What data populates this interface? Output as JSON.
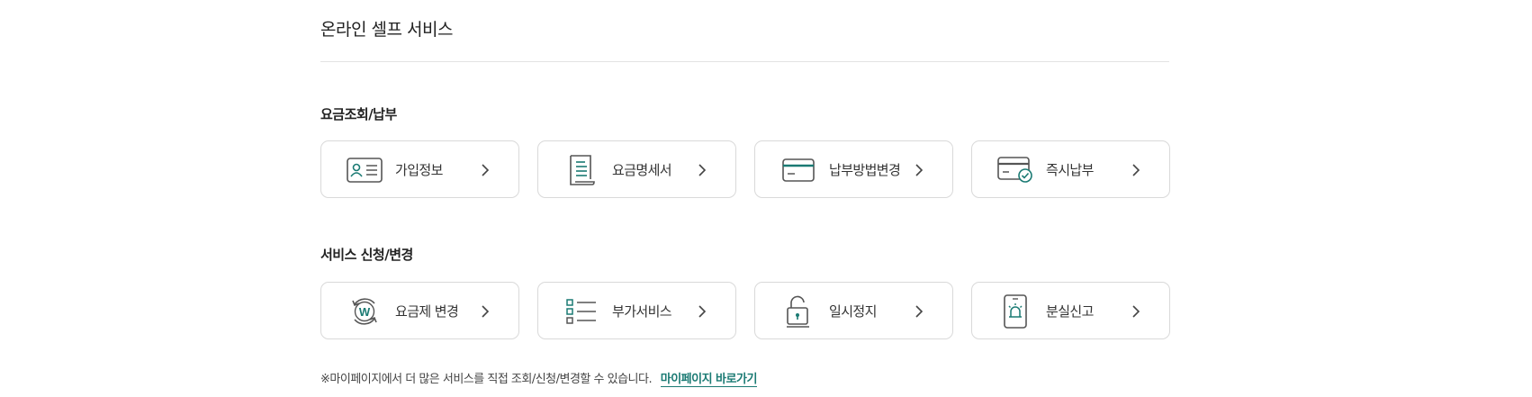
{
  "page": {
    "title": "온라인 셀프 서비스"
  },
  "sections": [
    {
      "title": "요금조회/납부",
      "items": [
        {
          "label": "가입정보",
          "icon": "id-card-icon"
        },
        {
          "label": "요금명세서",
          "icon": "bill-document-icon"
        },
        {
          "label": "납부방법변경",
          "icon": "credit-card-icon"
        },
        {
          "label": "즉시납부",
          "icon": "card-check-icon"
        }
      ]
    },
    {
      "title": "서비스 신청/변경",
      "items": [
        {
          "label": "요금제 변경",
          "icon": "plan-change-icon"
        },
        {
          "label": "부가서비스",
          "icon": "checklist-icon"
        },
        {
          "label": "일시정지",
          "icon": "unlock-icon"
        },
        {
          "label": "분실신고",
          "icon": "phone-alarm-icon"
        }
      ]
    }
  ],
  "notice": {
    "text": "※마이페이지에서 더 많은 서비스를 직접 조회/신청/변경할 수 있습니다.",
    "link": "마이페이지 바로가기"
  },
  "colors": {
    "accent": "#1a7a73",
    "icon_gray": "#555555",
    "border": "#d9d9d9"
  }
}
